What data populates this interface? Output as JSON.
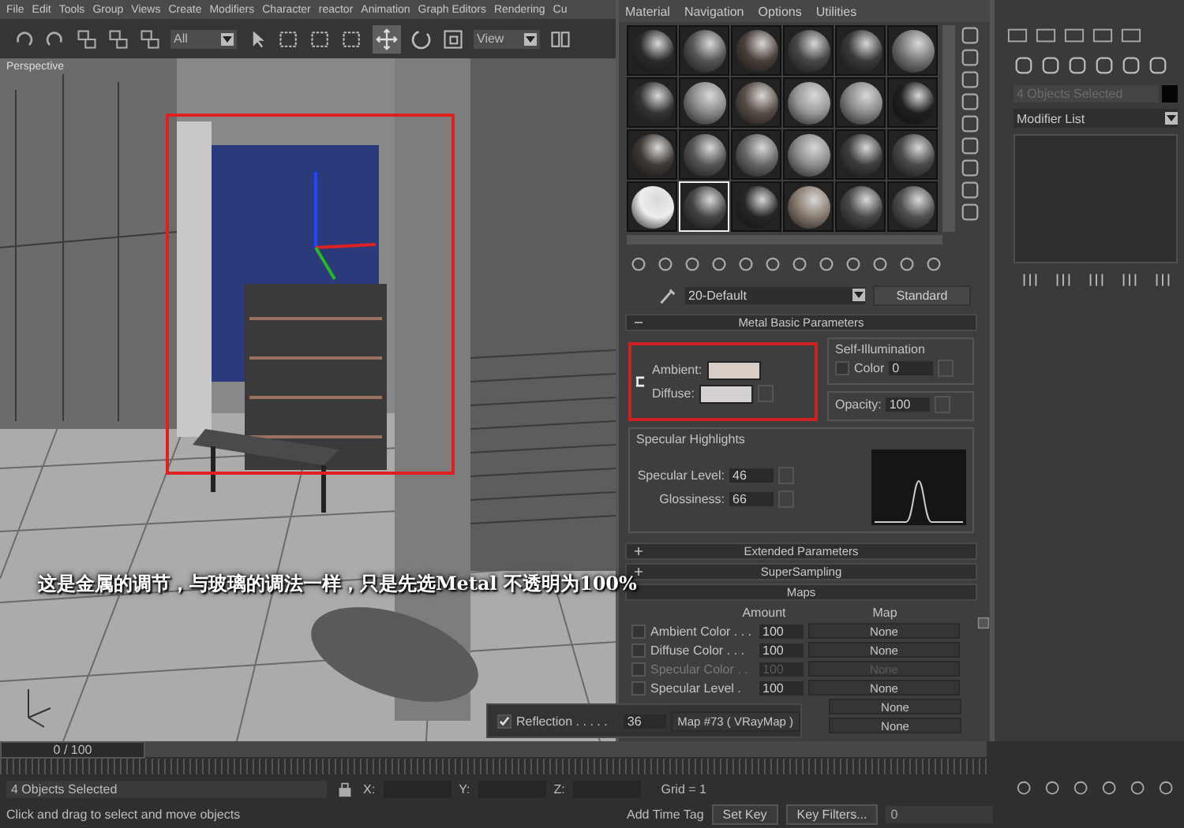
{
  "menu_bar": {
    "items": [
      "File",
      "Edit",
      "Tools",
      "Group",
      "Views",
      "Create",
      "Modifiers",
      "Character",
      "reactor",
      "Animation",
      "Graph Editors",
      "Rendering",
      "Cu"
    ]
  },
  "toolbar": {
    "selection_filter": "All",
    "reference_coord": "View"
  },
  "viewport": {
    "label": "Perspective",
    "caption": "这是金属的调节，与玻璃的调法一样，只是先选Metal  不透明为100%"
  },
  "material_editor": {
    "menu": [
      "Material",
      "Navigation",
      "Options",
      "Utilities"
    ],
    "slots": [
      {
        "selected": false
      },
      {
        "selected": false
      },
      {
        "selected": false
      },
      {
        "selected": false
      },
      {
        "selected": false
      },
      {
        "selected": false
      },
      {
        "selected": false
      },
      {
        "selected": false
      },
      {
        "selected": false
      },
      {
        "selected": false
      },
      {
        "selected": false
      },
      {
        "selected": false
      },
      {
        "selected": false
      },
      {
        "selected": false
      },
      {
        "selected": false
      },
      {
        "selected": false
      },
      {
        "selected": false
      },
      {
        "selected": false
      },
      {
        "selected": false
      },
      {
        "selected": true
      },
      {
        "selected": false
      },
      {
        "selected": false
      },
      {
        "selected": false
      },
      {
        "selected": false
      }
    ],
    "material_name": "20-Default",
    "material_type": "Standard",
    "basic_rollout": {
      "title": "Metal Basic Parameters",
      "expanded": true,
      "ambient_label": "Ambient:",
      "diffuse_label": "Diffuse:",
      "self_illumination": {
        "title": "Self-Illumination",
        "color_label": "Color",
        "color_checked": false,
        "value": "0"
      },
      "opacity": {
        "label": "Opacity:",
        "value": "100"
      },
      "specular": {
        "title": "Specular Highlights",
        "fields": [
          {
            "label": "Specular Level:",
            "value": "46"
          },
          {
            "label": "Glossiness:",
            "value": "66"
          }
        ]
      }
    },
    "collapsed_rollouts": [
      {
        "title": "Extended Parameters",
        "expanded": false
      },
      {
        "title": "SuperSampling",
        "expanded": false
      }
    ],
    "maps": {
      "title": "Maps",
      "headers": [
        "Amount",
        "Map"
      ],
      "rows": [
        {
          "label": "Ambient Color . . .",
          "checked": false,
          "disabled": false,
          "amount": "100",
          "map": "None"
        },
        {
          "label": "Diffuse Color . . .",
          "checked": false,
          "disabled": false,
          "amount": "100",
          "map": "None"
        },
        {
          "label": "Specular Color . .",
          "checked": false,
          "disabled": true,
          "amount": "100",
          "map": "None"
        },
        {
          "label": "Specular Level .",
          "checked": false,
          "disabled": false,
          "amount": "100",
          "map": "None"
        }
      ],
      "covered_maps": [
        "None",
        "None"
      ]
    }
  },
  "reflection_row": {
    "checked": true,
    "label": "Reflection . . . . .",
    "amount": "36",
    "map": "Map #73 ( VRayMap )"
  },
  "command_panel": {
    "object_name": "4 Objects Selected",
    "modifier_list": "Modifier List"
  },
  "timeline": {
    "frame": "0 / 100",
    "level": 0
  },
  "status_bar": {
    "selection": "4 Objects Selected",
    "prompt": "Click and drag to select and move objects",
    "coords": [
      "X:",
      "Y:",
      "Z:"
    ],
    "grid": "Grid = 1",
    "time_tag": "Add Time Tag",
    "set_key": "Set Key",
    "key_filters": "Key Filters...",
    "current_frame": "0"
  }
}
